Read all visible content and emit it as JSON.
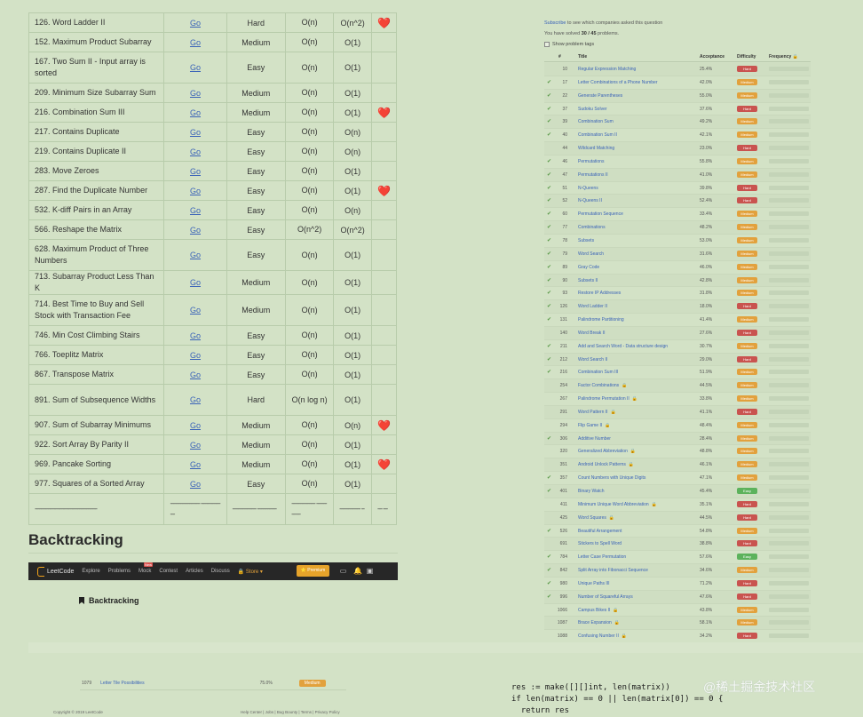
{
  "problems": [
    {
      "title": "126. Word Ladder II",
      "link": "Go",
      "difficulty": "Hard",
      "time": "O(n)",
      "space": "O(n^2)",
      "fav": "❤️",
      "tall": false
    },
    {
      "title": "152. Maximum Product Subarray",
      "link": "Go",
      "difficulty": "Medium",
      "time": "O(n)",
      "space": "O(1)",
      "fav": "",
      "tall": false
    },
    {
      "title": "167. Two Sum II - Input array is sorted",
      "link": "Go",
      "difficulty": "Easy",
      "time": "O(n)",
      "space": "O(1)",
      "fav": "",
      "tall": true
    },
    {
      "title": "209. Minimum Size Subarray Sum",
      "link": "Go",
      "difficulty": "Medium",
      "time": "O(n)",
      "space": "O(1)",
      "fav": "",
      "tall": false
    },
    {
      "title": "216. Combination Sum III",
      "link": "Go",
      "difficulty": "Medium",
      "time": "O(n)",
      "space": "O(1)",
      "fav": "❤️",
      "tall": false
    },
    {
      "title": "217. Contains Duplicate",
      "link": "Go",
      "difficulty": "Easy",
      "time": "O(n)",
      "space": "O(n)",
      "fav": "",
      "tall": false
    },
    {
      "title": "219. Contains Duplicate II",
      "link": "Go",
      "difficulty": "Easy",
      "time": "O(n)",
      "space": "O(n)",
      "fav": "",
      "tall": false
    },
    {
      "title": "283. Move Zeroes",
      "link": "Go",
      "difficulty": "Easy",
      "time": "O(n)",
      "space": "O(1)",
      "fav": "",
      "tall": false
    },
    {
      "title": "287. Find the Duplicate Number",
      "link": "Go",
      "difficulty": "Easy",
      "time": "O(n)",
      "space": "O(1)",
      "fav": "❤️",
      "tall": false
    },
    {
      "title": "532. K-diff Pairs in an Array",
      "link": "Go",
      "difficulty": "Easy",
      "time": "O(n)",
      "space": "O(n)",
      "fav": "",
      "tall": false
    },
    {
      "title": "566. Reshape the Matrix",
      "link": "Go",
      "difficulty": "Easy",
      "time": "O(n^2)",
      "space": "O(n^2)",
      "fav": "",
      "tall": false
    },
    {
      "title": "628. Maximum Product of Three Numbers",
      "link": "Go",
      "difficulty": "Easy",
      "time": "O(n)",
      "space": "O(1)",
      "fav": "",
      "tall": true
    },
    {
      "title": "713. Subarray Product Less Than K",
      "link": "Go",
      "difficulty": "Medium",
      "time": "O(n)",
      "space": "O(1)",
      "fav": "",
      "tall": false
    },
    {
      "title": "714. Best Time to Buy and Sell Stock with Transaction Fee",
      "link": "Go",
      "difficulty": "Medium",
      "time": "O(n)",
      "space": "O(1)",
      "fav": "",
      "tall": true
    },
    {
      "title": "746. Min Cost Climbing Stairs",
      "link": "Go",
      "difficulty": "Easy",
      "time": "O(n)",
      "space": "O(1)",
      "fav": "",
      "tall": false
    },
    {
      "title": "766. Toeplitz Matrix",
      "link": "Go",
      "difficulty": "Easy",
      "time": "O(n)",
      "space": "O(1)",
      "fav": "",
      "tall": false
    },
    {
      "title": "867. Transpose Matrix",
      "link": "Go",
      "difficulty": "Easy",
      "time": "O(n)",
      "space": "O(1)",
      "fav": "",
      "tall": false
    },
    {
      "title": "891. Sum of Subsequence Widths",
      "link": "Go",
      "difficulty": "Hard",
      "time": "O(n log n)",
      "space": "O(1)",
      "fav": "",
      "tall": true
    },
    {
      "title": "907. Sum of Subarray Minimums",
      "link": "Go",
      "difficulty": "Medium",
      "time": "O(n)",
      "space": "O(n)",
      "fav": "❤️",
      "tall": false
    },
    {
      "title": "922. Sort Array By Parity II",
      "link": "Go",
      "difficulty": "Medium",
      "time": "O(n)",
      "space": "O(1)",
      "fav": "",
      "tall": false
    },
    {
      "title": "969. Pancake Sorting",
      "link": "Go",
      "difficulty": "Medium",
      "time": "O(n)",
      "space": "O(1)",
      "fav": "❤️",
      "tall": false
    },
    {
      "title": "977. Squares of a Sorted Array",
      "link": "Go",
      "difficulty": "Easy",
      "time": "O(n)",
      "space": "O(1)",
      "fav": "",
      "tall": false
    }
  ],
  "dash_row": {
    "title": "------------------------------------------",
    "link": "-------------------- ----------------",
    "difficulty": "---------------- -------------",
    "time": "---------------- -------------",
    "space": "-------------- --",
    "fav": "--- ---"
  },
  "section_heading": "Backtracking",
  "navbar": {
    "logo": "LeetCode",
    "items": [
      "Explore",
      "Problems",
      "Mock",
      "Contest",
      "Articles",
      "Discuss"
    ],
    "mock_badge": "New",
    "store": "🔒 Store ▾",
    "premium": "⭐ Premium"
  },
  "page_title": "Backtracking",
  "right_panel": {
    "subscribe_link": "Subscribe",
    "subscribe_text": " to see which companies asked this question",
    "solved_prefix": "You have solved ",
    "solved_count": "30 / 45",
    "solved_suffix": " problems.",
    "show_tags": "Show problem tags",
    "headers": {
      "num": "#",
      "title": "Title",
      "acceptance": "Acceptance",
      "difficulty": "Difficulty",
      "frequency": "Frequency 🔒"
    },
    "rows": [
      {
        "solved": false,
        "num": "10",
        "title": "Regular Expression Matching",
        "locked": false,
        "acc": "25.4%",
        "diff": "Hard"
      },
      {
        "solved": true,
        "num": "17",
        "title": "Letter Combinations of a Phone Number",
        "locked": false,
        "acc": "42.0%",
        "diff": "Medium"
      },
      {
        "solved": true,
        "num": "22",
        "title": "Generate Parentheses",
        "locked": false,
        "acc": "55.0%",
        "diff": "Medium"
      },
      {
        "solved": true,
        "num": "37",
        "title": "Sudoku Solver",
        "locked": false,
        "acc": "37.6%",
        "diff": "Hard"
      },
      {
        "solved": true,
        "num": "39",
        "title": "Combination Sum",
        "locked": false,
        "acc": "49.2%",
        "diff": "Medium"
      },
      {
        "solved": true,
        "num": "40",
        "title": "Combination Sum II",
        "locked": false,
        "acc": "42.1%",
        "diff": "Medium"
      },
      {
        "solved": false,
        "num": "44",
        "title": "Wildcard Matching",
        "locked": false,
        "acc": "23.0%",
        "diff": "Hard"
      },
      {
        "solved": true,
        "num": "46",
        "title": "Permutations",
        "locked": false,
        "acc": "55.8%",
        "diff": "Medium"
      },
      {
        "solved": true,
        "num": "47",
        "title": "Permutations II",
        "locked": false,
        "acc": "41.0%",
        "diff": "Medium"
      },
      {
        "solved": true,
        "num": "51",
        "title": "N-Queens",
        "locked": false,
        "acc": "39.8%",
        "diff": "Hard"
      },
      {
        "solved": true,
        "num": "52",
        "title": "N-Queens II",
        "locked": false,
        "acc": "52.4%",
        "diff": "Hard"
      },
      {
        "solved": true,
        "num": "60",
        "title": "Permutation Sequence",
        "locked": false,
        "acc": "33.4%",
        "diff": "Medium"
      },
      {
        "solved": true,
        "num": "77",
        "title": "Combinations",
        "locked": false,
        "acc": "48.2%",
        "diff": "Medium"
      },
      {
        "solved": true,
        "num": "78",
        "title": "Subsets",
        "locked": false,
        "acc": "53.0%",
        "diff": "Medium"
      },
      {
        "solved": true,
        "num": "79",
        "title": "Word Search",
        "locked": false,
        "acc": "31.6%",
        "diff": "Medium"
      },
      {
        "solved": true,
        "num": "89",
        "title": "Gray Code",
        "locked": false,
        "acc": "46.0%",
        "diff": "Medium"
      },
      {
        "solved": true,
        "num": "90",
        "title": "Subsets II",
        "locked": false,
        "acc": "42.8%",
        "diff": "Medium"
      },
      {
        "solved": true,
        "num": "93",
        "title": "Restore IP Addresses",
        "locked": false,
        "acc": "31.8%",
        "diff": "Medium"
      },
      {
        "solved": true,
        "num": "126",
        "title": "Word Ladder II",
        "locked": false,
        "acc": "18.0%",
        "diff": "Hard"
      },
      {
        "solved": true,
        "num": "131",
        "title": "Palindrome Partitioning",
        "locked": false,
        "acc": "41.4%",
        "diff": "Medium"
      },
      {
        "solved": false,
        "num": "140",
        "title": "Word Break II",
        "locked": false,
        "acc": "27.6%",
        "diff": "Hard"
      },
      {
        "solved": true,
        "num": "211",
        "title": "Add and Search Word - Data structure design",
        "locked": false,
        "acc": "30.7%",
        "diff": "Medium"
      },
      {
        "solved": true,
        "num": "212",
        "title": "Word Search II",
        "locked": false,
        "acc": "29.0%",
        "diff": "Hard"
      },
      {
        "solved": true,
        "num": "216",
        "title": "Combination Sum III",
        "locked": false,
        "acc": "51.9%",
        "diff": "Medium"
      },
      {
        "solved": false,
        "num": "254",
        "title": "Factor Combinations",
        "locked": true,
        "acc": "44.5%",
        "diff": "Medium"
      },
      {
        "solved": false,
        "num": "267",
        "title": "Palindrome Permutation II",
        "locked": true,
        "acc": "33.8%",
        "diff": "Medium"
      },
      {
        "solved": false,
        "num": "291",
        "title": "Word Pattern II",
        "locked": true,
        "acc": "41.1%",
        "diff": "Hard"
      },
      {
        "solved": false,
        "num": "294",
        "title": "Flip Game II",
        "locked": true,
        "acc": "48.4%",
        "diff": "Medium"
      },
      {
        "solved": true,
        "num": "306",
        "title": "Additive Number",
        "locked": false,
        "acc": "28.4%",
        "diff": "Medium"
      },
      {
        "solved": false,
        "num": "320",
        "title": "Generalized Abbreviation",
        "locked": true,
        "acc": "48.8%",
        "diff": "Medium"
      },
      {
        "solved": false,
        "num": "351",
        "title": "Android Unlock Patterns",
        "locked": true,
        "acc": "46.1%",
        "diff": "Medium"
      },
      {
        "solved": true,
        "num": "357",
        "title": "Count Numbers with Unique Digits",
        "locked": false,
        "acc": "47.1%",
        "diff": "Medium"
      },
      {
        "solved": true,
        "num": "401",
        "title": "Binary Watch",
        "locked": false,
        "acc": "45.4%",
        "diff": "Easy"
      },
      {
        "solved": false,
        "num": "411",
        "title": "Minimum Unique Word Abbreviation",
        "locked": true,
        "acc": "35.1%",
        "diff": "Hard"
      },
      {
        "solved": false,
        "num": "425",
        "title": "Word Squares",
        "locked": true,
        "acc": "44.5%",
        "diff": "Hard"
      },
      {
        "solved": true,
        "num": "526",
        "title": "Beautiful Arrangement",
        "locked": false,
        "acc": "54.8%",
        "diff": "Medium"
      },
      {
        "solved": false,
        "num": "691",
        "title": "Stickers to Spell Word",
        "locked": false,
        "acc": "38.8%",
        "diff": "Hard"
      },
      {
        "solved": true,
        "num": "784",
        "title": "Letter Case Permutation",
        "locked": false,
        "acc": "57.6%",
        "diff": "Easy"
      },
      {
        "solved": true,
        "num": "842",
        "title": "Split Array into Fibonacci Sequence",
        "locked": false,
        "acc": "34.6%",
        "diff": "Medium"
      },
      {
        "solved": true,
        "num": "980",
        "title": "Unique Paths III",
        "locked": false,
        "acc": "71.2%",
        "diff": "Hard"
      },
      {
        "solved": true,
        "num": "996",
        "title": "Number of Squareful Arrays",
        "locked": false,
        "acc": "47.6%",
        "diff": "Hard"
      },
      {
        "solved": false,
        "num": "1066",
        "title": "Campus Bikes II",
        "locked": true,
        "acc": "43.8%",
        "diff": "Medium"
      },
      {
        "solved": false,
        "num": "1087",
        "title": "Brace Expansion",
        "locked": true,
        "acc": "58.1%",
        "diff": "Medium"
      },
      {
        "solved": false,
        "num": "1088",
        "title": "Confusing Number II",
        "locked": true,
        "acc": "34.2%",
        "diff": "Hard"
      }
    ]
  },
  "bottom_left": {
    "num": "1079",
    "title": "Letter Tile Possibilities",
    "acc": "75.0%",
    "diff": "Medium"
  },
  "footer": {
    "copyright": "Copyright © 2019 LeetCode",
    "links": "Help Center  |  Jobs  |  Bug Bounty  |  Terms  |  Privacy Policy"
  },
  "code_lines": [
    "res := make([][]int, len(matrix))",
    "if len(matrix) == 0 || len(matrix[0]) == 0 {",
    "  return res"
  ],
  "watermark": "@稀土掘金技术社区"
}
